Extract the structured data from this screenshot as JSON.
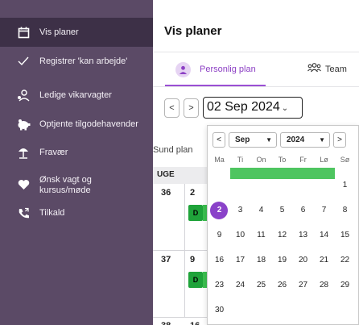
{
  "sidebar": {
    "items": [
      {
        "label": "Vis planer",
        "icon": "calendar-icon",
        "active": true
      },
      {
        "label": "Registrer 'kan arbejde'",
        "icon": "checkmark-icon"
      },
      {
        "label": "Ledige vikarvagter",
        "icon": "person-search-icon"
      },
      {
        "label": "Optjente tilgodehavender",
        "icon": "piggy-bank-icon"
      },
      {
        "label": "Fravær",
        "icon": "beach-umbrella-icon"
      },
      {
        "label": "Ønsk vagt og",
        "label2": "kursus/møde",
        "icon": "heart-icon"
      },
      {
        "label": "Tilkald",
        "icon": "phone-call-icon"
      }
    ]
  },
  "main": {
    "title": "Vis planer",
    "tabs": [
      {
        "label": "Personlig plan",
        "active": true
      },
      {
        "label": "Team"
      }
    ],
    "prev_label": "<",
    "next_label": ">",
    "date_value": "02 Sep 2024",
    "plan_label": "Sund plan",
    "week_header": "UGE",
    "weeks": [
      {
        "week": "36",
        "day": "2",
        "shift": "D"
      },
      {
        "week": "37",
        "day": "9",
        "shift": "D"
      },
      {
        "week": "38",
        "day": "16"
      }
    ]
  },
  "calendar": {
    "prev_label": "<",
    "next_label": ">",
    "month_value": "Sep",
    "year_value": "2024",
    "weekdays": [
      "Ma",
      "Ti",
      "On",
      "To",
      "Fr",
      "Lø",
      "Sø"
    ],
    "weeks": [
      [
        "",
        "",
        "",
        "",
        "",
        "",
        "1"
      ],
      [
        "2",
        "3",
        "4",
        "5",
        "6",
        "7",
        "8"
      ],
      [
        "9",
        "10",
        "11",
        "12",
        "13",
        "14",
        "15"
      ],
      [
        "16",
        "17",
        "18",
        "19",
        "20",
        "21",
        "22"
      ],
      [
        "23",
        "24",
        "25",
        "26",
        "27",
        "28",
        "29"
      ],
      [
        "30",
        "",
        "",
        "",
        "",
        "",
        ""
      ]
    ],
    "selected_day": "2"
  },
  "colors": {
    "sidebar_bg": "#5b4a66",
    "sidebar_active": "#3d3047",
    "accent": "#8a42c9",
    "shift_green": "#1fa33a"
  }
}
